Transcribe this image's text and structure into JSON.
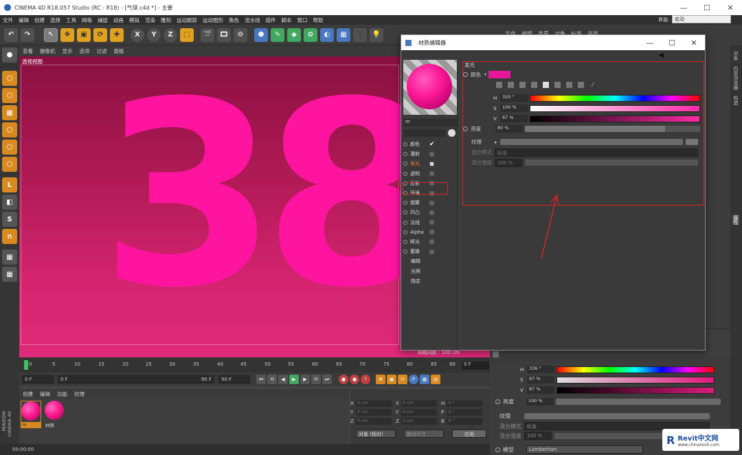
{
  "window": {
    "title": "CINEMA 4D R18.057 Studio (RC - R18) - [气球.c4d *] - 主要",
    "min": "—",
    "max": "☐",
    "close": "✕"
  },
  "menu": [
    "文件",
    "编辑",
    "创建",
    "选择",
    "工具",
    "网格",
    "捕捉",
    "动画",
    "模拟",
    "渲染",
    "雕刻",
    "运动跟踪",
    "运动图形",
    "角色",
    "流水线",
    "插件",
    "脚本",
    "窗口",
    "帮助"
  ],
  "layout": {
    "label": "界面:",
    "value": "启动"
  },
  "toolbar": {
    "x": "X",
    "y": "Y",
    "z": "Z"
  },
  "viewport": {
    "menu": [
      "查看",
      "摄像机",
      "显示",
      "选项",
      "过滤",
      "面板"
    ],
    "label": "透视视图",
    "content_text": "38",
    "grid_info": "网格间距 : 100 cm"
  },
  "timeline": {
    "ticks": [
      "0",
      "5",
      "10",
      "15",
      "20",
      "25",
      "30",
      "35",
      "40",
      "45",
      "50",
      "55",
      "60",
      "65",
      "70",
      "75",
      "80",
      "85",
      "90"
    ],
    "frame_field": "0 F"
  },
  "transport": {
    "start": "0 F",
    "range_start": "0 F",
    "range_end": "90 F",
    "end": "90 F",
    "p": "P"
  },
  "material_manager": {
    "menu": [
      "创建",
      "编辑",
      "功能",
      "纹理"
    ],
    "materials": [
      {
        "label": "m"
      },
      {
        "label": "材质"
      }
    ]
  },
  "brand": {
    "maxon": "MAXON",
    "c4d": "CINEMA 4D"
  },
  "coordinates": {
    "rows": [
      {
        "a": "X",
        "av": "0 cm",
        "b": "X",
        "bv": "0 cm",
        "c": "H",
        "cv": "0 °"
      },
      {
        "a": "Y",
        "av": "0 cm",
        "b": "Y",
        "bv": "0 cm",
        "c": "P",
        "cv": "0 °"
      },
      {
        "a": "Z",
        "av": "0 cm",
        "b": "Z",
        "bv": "0 cm",
        "c": "B",
        "cv": "0 °"
      }
    ],
    "mode": "对象 (相对)",
    "size_mode": "绝对尺寸",
    "apply": "应用"
  },
  "status": {
    "time": "00:00:00"
  },
  "right_panel": {
    "tabs": [
      "文件",
      "编辑",
      "查看",
      "对象",
      "标签",
      "书签"
    ],
    "vertical_tabs": [
      "对象",
      "内容浏览器",
      "构造",
      "属性"
    ],
    "lower": {
      "h_label": "H",
      "h_value": "336 °",
      "s_label": "S",
      "s_value": "97 %",
      "v_label": "V",
      "v_value": "87 %",
      "brightness_label": "亮度",
      "brightness_value": "100 %",
      "texture_label": "纹理",
      "blend_mode_label": "混合模式",
      "blend_mode_value": "标准",
      "blend_strength_label": "混合强度",
      "blend_strength_value": "100 %",
      "model_label": "模型",
      "model_value": "Lambertian"
    }
  },
  "material_editor": {
    "title": "材质编辑器",
    "material_name": "m",
    "channels": [
      {
        "name": "颜色",
        "checked": true
      },
      {
        "name": "漫射",
        "checked": false
      },
      {
        "name": "发光",
        "checked": true
      },
      {
        "name": "透明",
        "checked": false
      },
      {
        "name": "反射",
        "checked": false
      },
      {
        "name": "环境",
        "checked": false
      },
      {
        "name": "烟雾",
        "checked": false
      },
      {
        "name": "凹凸",
        "checked": false
      },
      {
        "name": "法线",
        "checked": false
      },
      {
        "name": "Alpha",
        "checked": false
      },
      {
        "name": "辉光",
        "checked": false
      },
      {
        "name": "置换",
        "checked": false
      }
    ],
    "extra": [
      "编辑",
      "光照",
      "指定"
    ],
    "section": "发光",
    "color_label": "颜色",
    "color_value": "#e8189a",
    "h_label": "H",
    "h_value": "320 °",
    "s_label": "S",
    "s_value": "100 %",
    "v_label": "V",
    "v_value": "87 %",
    "brightness_label": "亮度",
    "brightness_value": "80 %",
    "texture_label": "纹理",
    "blend_mode_label": "混合模式",
    "blend_mode_value": "标准",
    "blend_strength_label": "混合强度",
    "blend_strength_value": "100 %",
    "highlight_color": "#dd2222"
  },
  "watermark": {
    "brand": "Revit中文网",
    "url": "www.chinarevit.com"
  }
}
